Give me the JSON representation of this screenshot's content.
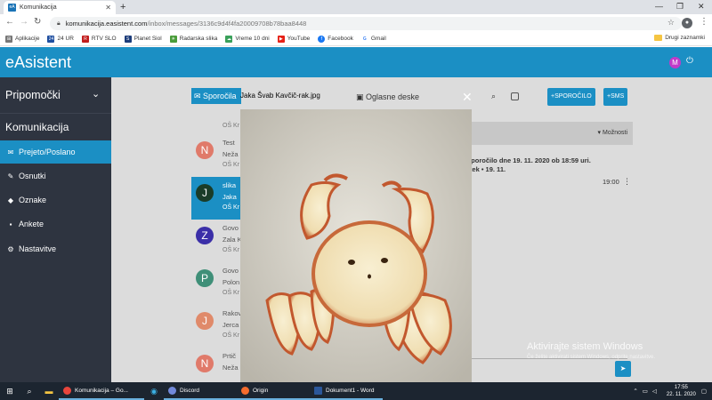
{
  "browser": {
    "tab_title": "Komunikacija",
    "tab_favicon": "eA",
    "url_host": "komunikacija.easistent.com",
    "url_path": "/inbox/messages/3136c9d4f4fa20009708b78baa8448",
    "bookmarks": [
      "Aplikacije",
      "24 UR",
      "RTV SLO",
      "Planet Siol",
      "Radarska slika",
      "Vreme 10 dni",
      "YouTube",
      "Facebook",
      "Gmail"
    ],
    "bookmark_icons": [
      "⊞",
      "24",
      "R",
      "S",
      "✳",
      "☁",
      "▶",
      "f",
      "G"
    ],
    "other_bookmarks": "Drugi zaznamki",
    "profile_icon": "person-icon"
  },
  "app": {
    "logo": "eAsistent",
    "user_initial": "M"
  },
  "sidebar": {
    "tools_label": "Pripomočki",
    "section_label": "Komunikacija",
    "items": [
      {
        "label": "Prejeto/Poslano",
        "icon": "✉"
      },
      {
        "label": "Osnutki",
        "icon": "✎"
      },
      {
        "label": "Oznake",
        "icon": "◆"
      },
      {
        "label": "Ankete",
        "icon": "▪"
      },
      {
        "label": "Nastavitve",
        "icon": "⚙"
      }
    ]
  },
  "toolbar": {
    "sporocila": "Sporočila",
    "oglasne": "Oglasne deske",
    "new_message": "SPOROČILO",
    "sms": "SMS",
    "moznosti": "Možnosti"
  },
  "messages": [
    {
      "initial": "N",
      "title": "Test",
      "sender": "Neža",
      "org": "OŠ Kr",
      "color": "#e07a6a"
    },
    {
      "initial": "J",
      "title": "slika",
      "sender": "Jaka",
      "org": "OŠ Kr",
      "color": "#1a3c28"
    },
    {
      "initial": "Z",
      "title": "Govo",
      "sender": "Zala K",
      "org": "OŠ Kr",
      "color": "#3b2fa8"
    },
    {
      "initial": "P",
      "title": "Govo",
      "sender": "Polon",
      "org": "OŠ Kr",
      "color": "#3f8f78"
    },
    {
      "initial": "J",
      "title": "Rakov",
      "sender": "Jerca",
      "org": "OŠ Kr",
      "color": "#e08a6a"
    },
    {
      "initial": "N",
      "title": "Prtič",
      "sender": "Neža",
      "org": "OŠ Kr",
      "color": "#e07a6a"
    }
  ],
  "top_org": "OŠ Kr",
  "detail": {
    "line1": "sporočilo dne 19. 11. 2020 ob 18:59 uri.",
    "line2": "rtek • 19. 11.",
    "time": "19:00"
  },
  "lightbox": {
    "filename": "Jaka Švab Kavčič-rak.jpg"
  },
  "watermark": {
    "line1": "Aktivirajte sistem Windows",
    "line2": "Če želite aktivirati sistem Windows, odprite nastavitve."
  },
  "taskbar": {
    "apps": [
      {
        "label": "Komunikacija – Go...",
        "color": "#e8453c"
      },
      {
        "label": "Discord",
        "color": "#7289da"
      },
      {
        "label": "Origin",
        "color": "#f56c2d"
      },
      {
        "label": "Dokument1 - Word",
        "color": "#2b579a"
      }
    ],
    "time": "17:55",
    "date": "22. 11. 2020"
  }
}
